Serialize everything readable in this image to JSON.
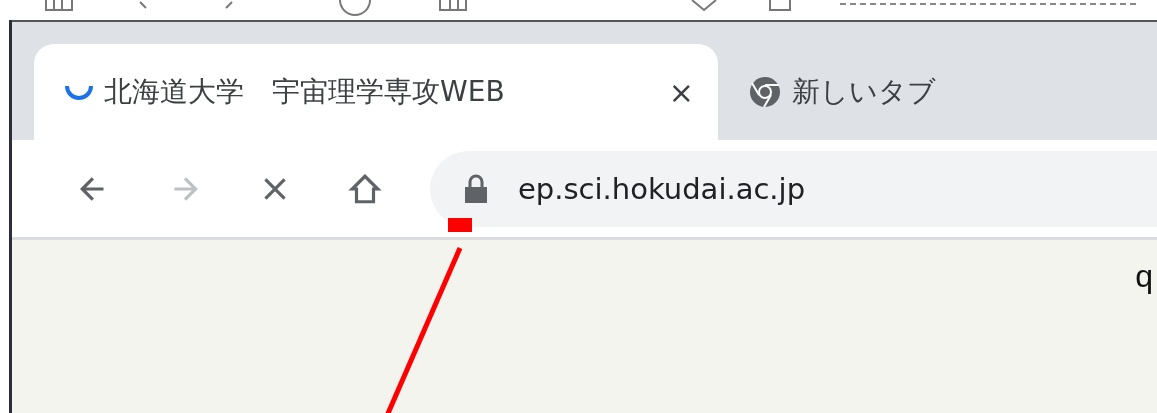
{
  "tabs": [
    {
      "title": "北海道大学　宇宙理学専攻WEB",
      "selected": true,
      "kind": "loading",
      "close": "×"
    },
    {
      "title": "新しいタブ",
      "selected": false,
      "kind": "chrome"
    }
  ],
  "toolbar": {
    "buttons": [
      {
        "kind": "back",
        "disabled": false
      },
      {
        "kind": "forward",
        "disabled": true
      },
      {
        "kind": "stop",
        "disabled": false
      },
      {
        "kind": "home",
        "disabled": false
      }
    ]
  },
  "address_bar": {
    "url": "ep.sci.hokudai.ac.jp",
    "secure": true
  },
  "page": {
    "text": "q"
  }
}
